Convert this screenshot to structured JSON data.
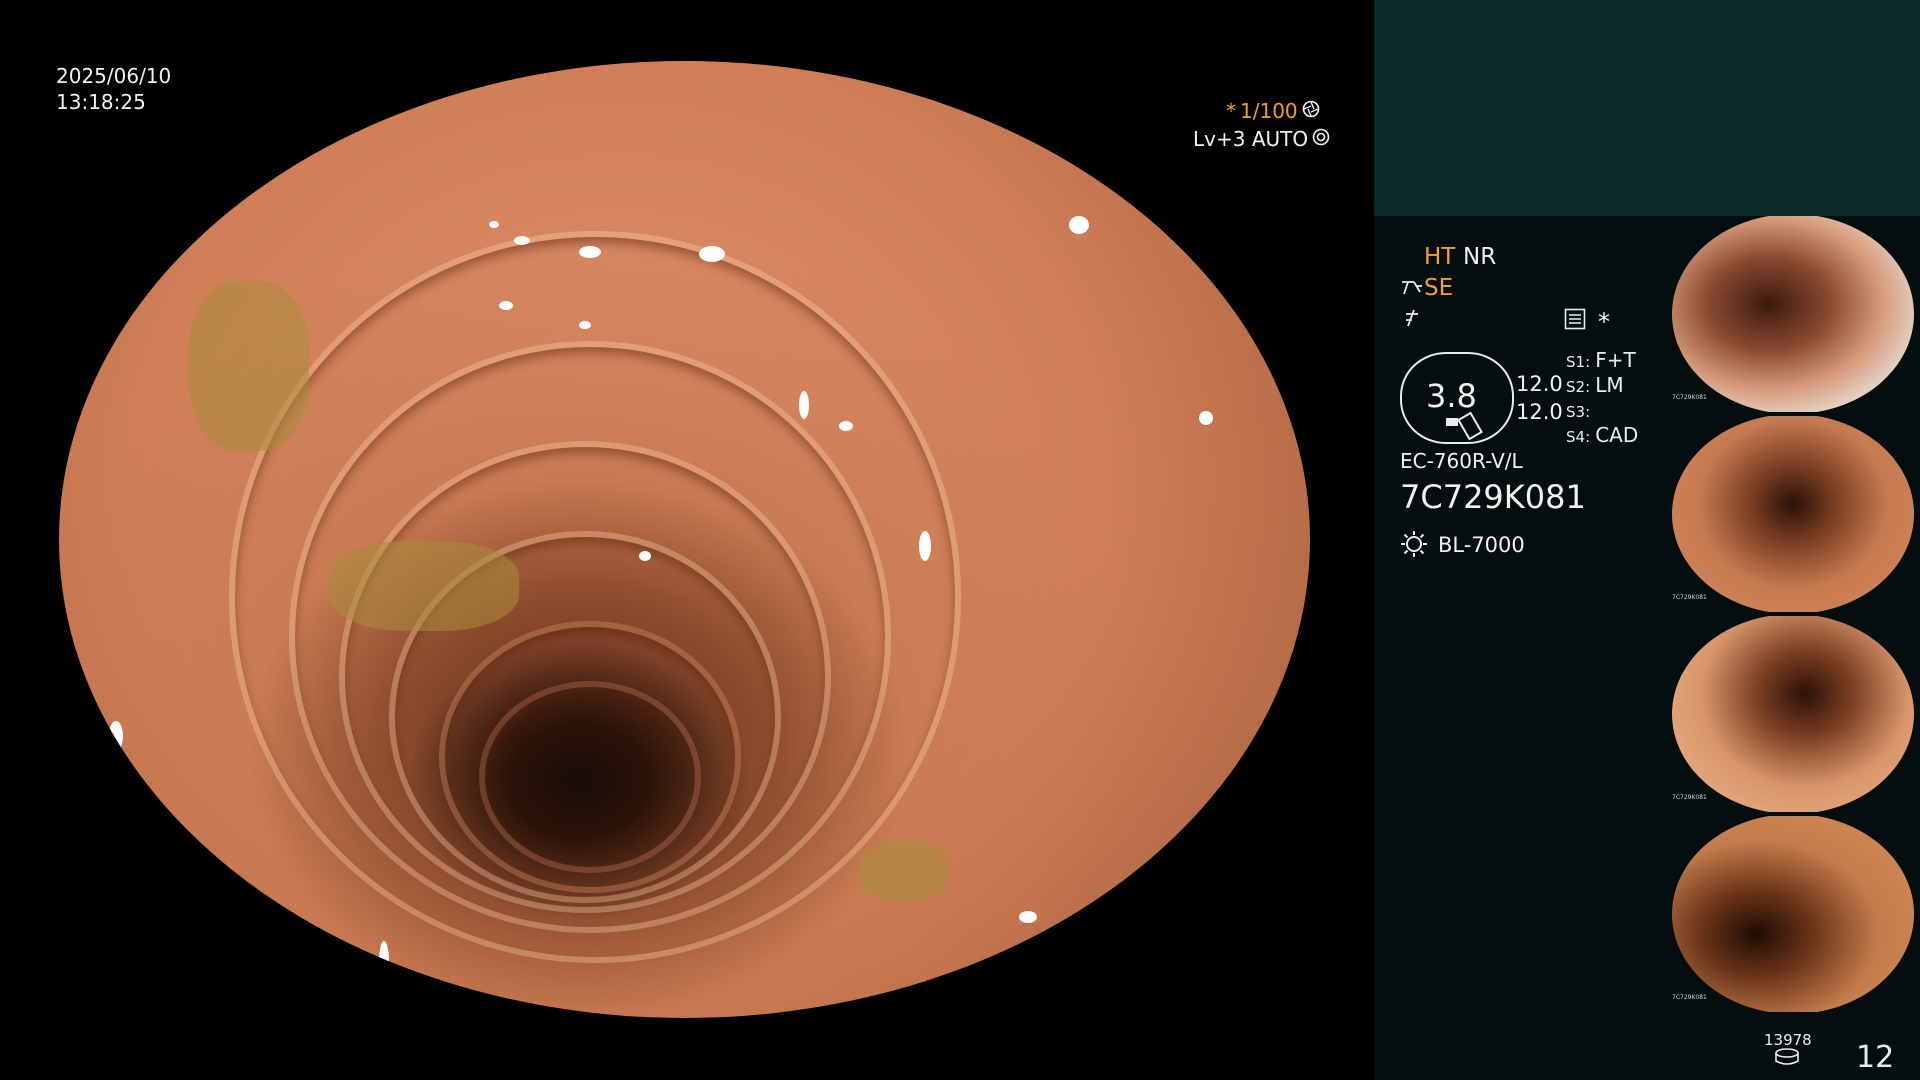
{
  "screen": {
    "date": "2025/06/10",
    "time": "13:18:25",
    "shutter_prefix": "*",
    "shutter": "1/100",
    "level": "Lv+3 AUTO"
  },
  "panel": {
    "ht": "HT",
    "nr": "NR",
    "se": "SE",
    "asterisk": "*",
    "gauge_value": "3.8",
    "value_1": "12.0",
    "value_2": "12.0",
    "switches": [
      {
        "key": "S1:",
        "value": "F+T"
      },
      {
        "key": "S2:",
        "value": "LM"
      },
      {
        "key": "S3:",
        "value": ""
      },
      {
        "key": "S4:",
        "value": "CAD"
      }
    ],
    "scope_model": "EC-760R-V/L",
    "serial": "7C729K081",
    "light_source": "BL-7000",
    "image_count": "13978",
    "page_number": "12"
  },
  "thumbnails": [
    {
      "id": "7C729K081"
    },
    {
      "id": "7C729K081"
    },
    {
      "id": "7C729K081"
    },
    {
      "id": "7C729K081"
    }
  ],
  "colors": {
    "accent_orange": "#f1a12a",
    "panel_teal": "#0b2a2c",
    "panel_dark": "#050e0f",
    "mucosa": "#d7855c"
  },
  "icons": [
    "aperture-icon",
    "auto-iris-icon",
    "highlight-icon",
    "structure-enhance-icon",
    "settings-list-icon",
    "light-source-icon",
    "storage-icon"
  ]
}
